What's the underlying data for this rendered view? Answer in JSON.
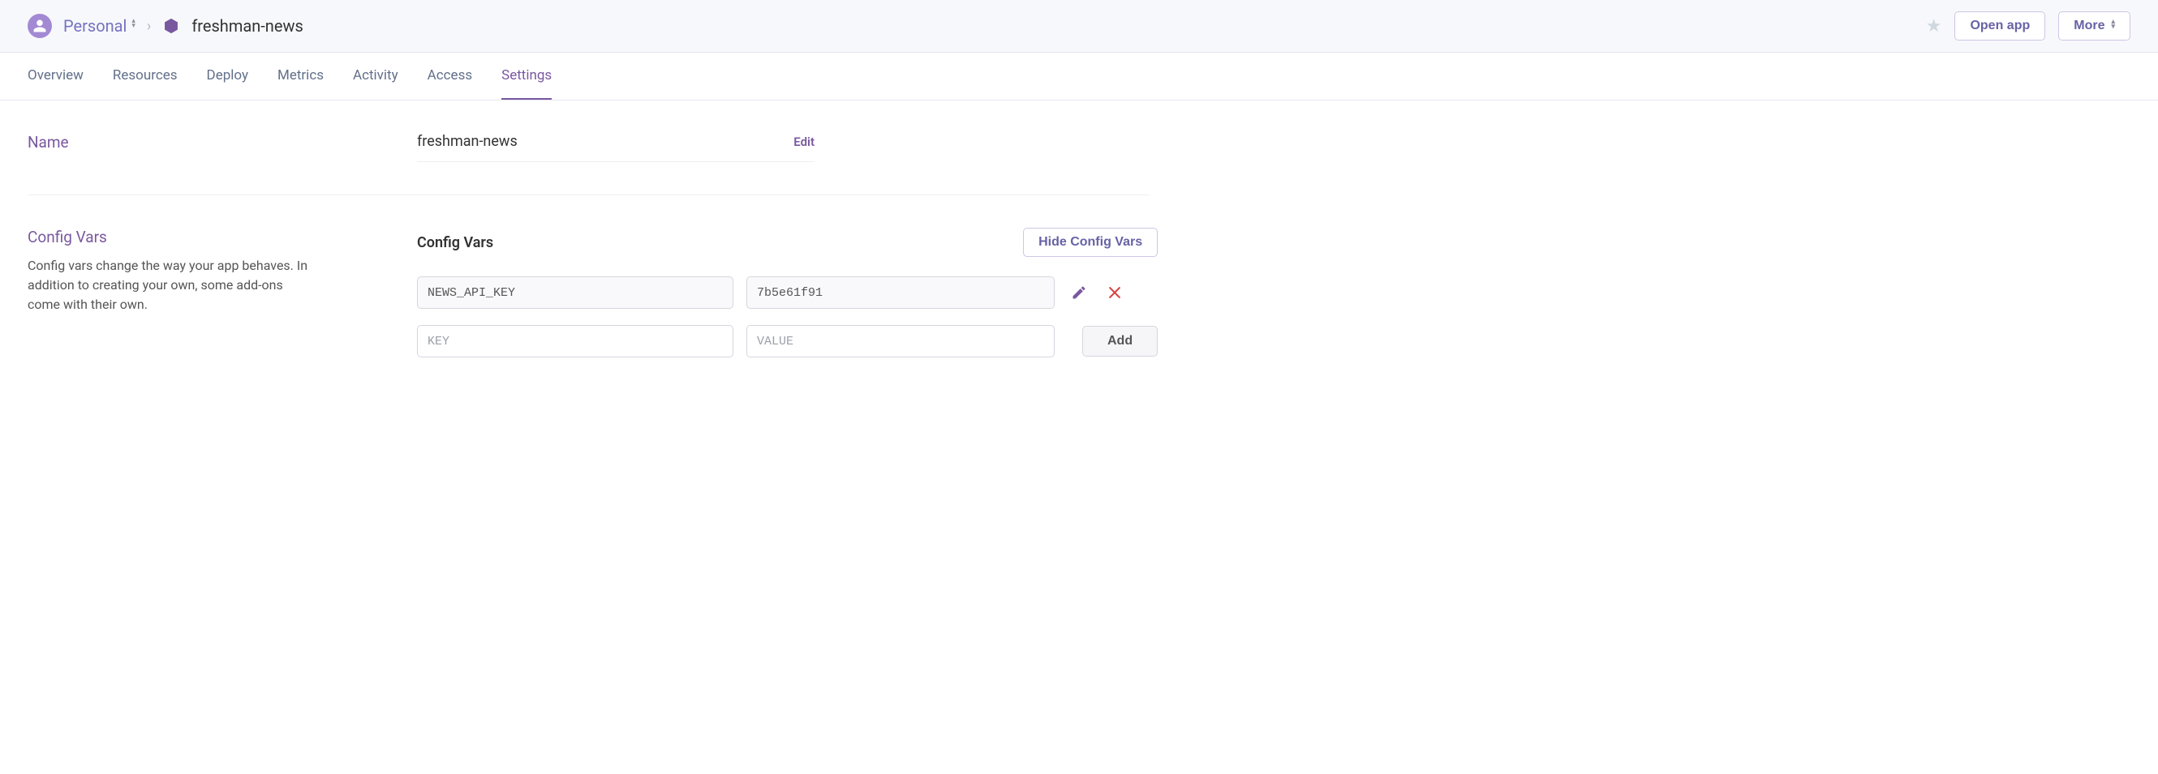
{
  "breadcrumb": {
    "account": "Personal",
    "app": "freshman-news"
  },
  "topbar": {
    "open_app": "Open app",
    "more": "More"
  },
  "tabs": [
    {
      "label": "Overview",
      "active": false
    },
    {
      "label": "Resources",
      "active": false
    },
    {
      "label": "Deploy",
      "active": false
    },
    {
      "label": "Metrics",
      "active": false
    },
    {
      "label": "Activity",
      "active": false
    },
    {
      "label": "Access",
      "active": false
    },
    {
      "label": "Settings",
      "active": true
    }
  ],
  "name_section": {
    "title": "Name",
    "value": "freshman-news",
    "edit": "Edit"
  },
  "config_section": {
    "title": "Config Vars",
    "description": "Config vars change the way your app behaves. In addition to creating your own, some add-ons come with their own.",
    "panel_title": "Config Vars",
    "hide_button": "Hide Config Vars",
    "vars": [
      {
        "key": "NEWS_API_KEY",
        "value": "7b5e61f91"
      }
    ],
    "new_key_placeholder": "KEY",
    "new_value_placeholder": "VALUE",
    "add_button": "Add"
  }
}
